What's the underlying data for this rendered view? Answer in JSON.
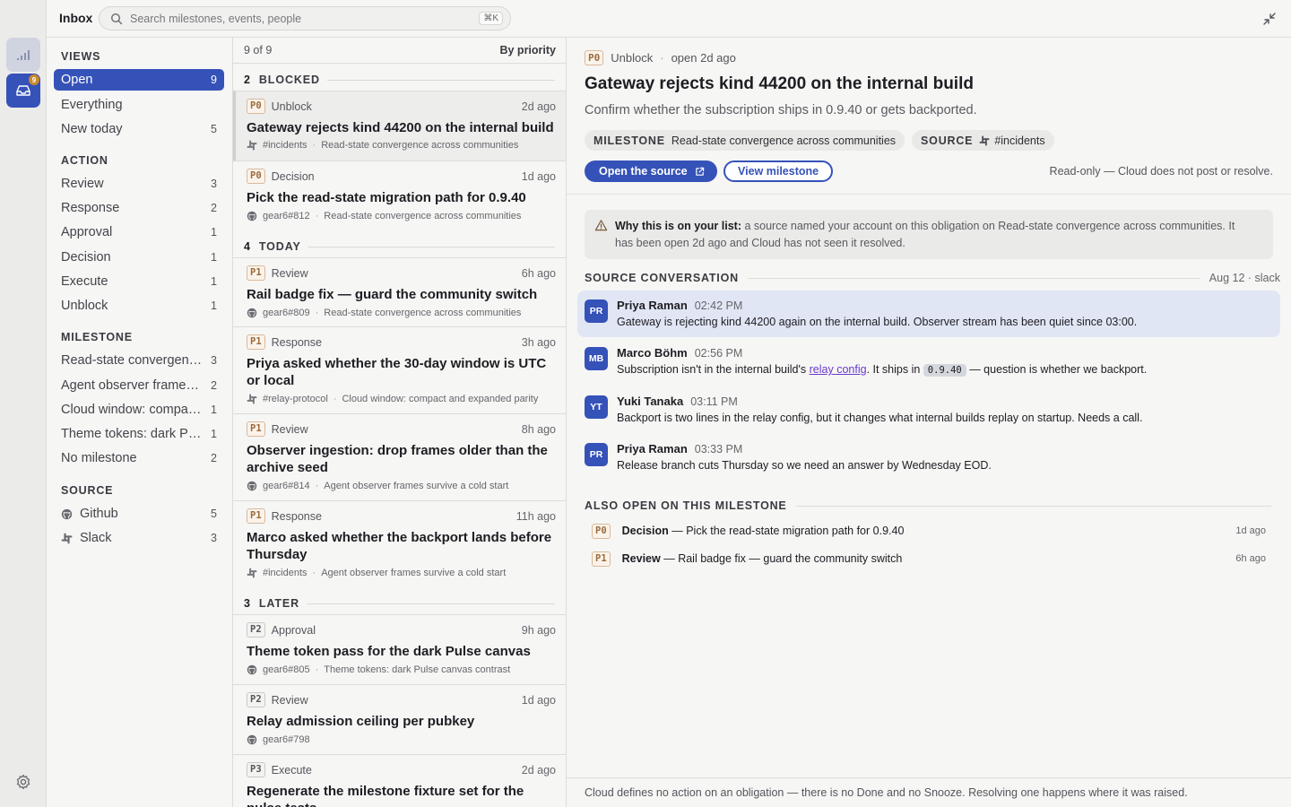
{
  "rail": {
    "inbox_badge": "9",
    "icons": [
      "signal-icon",
      "inbox-icon",
      "gear-icon"
    ]
  },
  "topbar": {
    "title": "Inbox",
    "search_placeholder": "Search milestones, events, people",
    "search_shortcut": "⌘K"
  },
  "sidebar": {
    "views_head": "VIEWS",
    "views": [
      {
        "label": "Open",
        "count": "9"
      },
      {
        "label": "Everything",
        "count": ""
      },
      {
        "label": "New today",
        "count": "5"
      }
    ],
    "action_head": "ACTION",
    "actions": [
      {
        "label": "Review",
        "count": "3"
      },
      {
        "label": "Response",
        "count": "2"
      },
      {
        "label": "Approval",
        "count": "1"
      },
      {
        "label": "Decision",
        "count": "1"
      },
      {
        "label": "Execute",
        "count": "1"
      },
      {
        "label": "Unblock",
        "count": "1"
      }
    ],
    "milestone_head": "MILESTONE",
    "milestones": [
      {
        "label": "Read-state convergence across communities",
        "count": "3"
      },
      {
        "label": "Agent observer frames survive a cold start",
        "count": "2"
      },
      {
        "label": "Cloud window: compact and expanded parity",
        "count": "1"
      },
      {
        "label": "Theme tokens: dark Pulse canvas contrast",
        "count": "1"
      },
      {
        "label": "No milestone",
        "count": "2"
      }
    ],
    "source_head": "SOURCE",
    "sources": [
      {
        "label": "Github",
        "count": "5",
        "icon": "github-icon"
      },
      {
        "label": "Slack",
        "count": "3",
        "icon": "slack-icon"
      }
    ]
  },
  "list": {
    "count": "9 of 9",
    "sort": "By priority",
    "groups": [
      {
        "n": "2",
        "label": "BLOCKED"
      },
      {
        "n": "4",
        "label": "TODAY"
      },
      {
        "n": "3",
        "label": "LATER"
      }
    ],
    "items": [
      {
        "prio": "P0",
        "type": "Unblock",
        "ago": "2d ago",
        "title": "Gateway rejects kind 44200 on the internal build",
        "source": "#incidents",
        "source_icon": "slack-icon",
        "milestone": "Read-state convergence across communities"
      },
      {
        "prio": "P0",
        "type": "Decision",
        "ago": "1d ago",
        "title": "Pick the read-state migration path for 0.9.40",
        "source": "gear6#812",
        "source_icon": "github-icon",
        "milestone": "Read-state convergence across communities"
      },
      {
        "prio": "P1",
        "type": "Review",
        "ago": "6h ago",
        "title": "Rail badge fix — guard the community switch",
        "source": "gear6#809",
        "source_icon": "github-icon",
        "milestone": "Read-state convergence across communities"
      },
      {
        "prio": "P1",
        "type": "Response",
        "ago": "3h ago",
        "title": "Priya asked whether the 30-day window is UTC or local",
        "source": "#relay-protocol",
        "source_icon": "slack-icon",
        "milestone": "Cloud window: compact and expanded parity"
      },
      {
        "prio": "P1",
        "type": "Review",
        "ago": "8h ago",
        "title": "Observer ingestion: drop frames older than the archive seed",
        "source": "gear6#814",
        "source_icon": "github-icon",
        "milestone": "Agent observer frames survive a cold start"
      },
      {
        "prio": "P1",
        "type": "Response",
        "ago": "11h ago",
        "title": "Marco asked whether the backport lands before Thursday",
        "source": "#incidents",
        "source_icon": "slack-icon",
        "milestone": "Agent observer frames survive a cold start"
      },
      {
        "prio": "P2",
        "type": "Approval",
        "ago": "9h ago",
        "title": "Theme token pass for the dark Pulse canvas",
        "source": "gear6#805",
        "source_icon": "github-icon",
        "milestone": "Theme tokens: dark Pulse canvas contrast"
      },
      {
        "prio": "P2",
        "type": "Review",
        "ago": "1d ago",
        "title": "Relay admission ceiling per pubkey",
        "source": "gear6#798",
        "source_icon": "github-icon",
        "milestone": ""
      },
      {
        "prio": "P3",
        "type": "Execute",
        "ago": "2d ago",
        "title": "Regenerate the milestone fixture set for the pulse tests",
        "source": "",
        "source_icon": "",
        "milestone": ""
      }
    ]
  },
  "detail": {
    "prio": "P0",
    "type": "Unblock",
    "age": "open 2d ago",
    "title": "Gateway rejects kind 44200 on the internal build",
    "subtitle": "Confirm whether the subscription ships in 0.9.40 or gets backported.",
    "chip_milestone_key": "MILESTONE",
    "chip_milestone_val": "Read-state convergence across communities",
    "chip_source_key": "SOURCE",
    "chip_source_val": "#incidents",
    "open_source_label": "Open the source",
    "view_milestone_label": "View milestone",
    "readonly_note": "Read-only — Cloud does not post or resolve.",
    "why_label": "Why this is on your list:",
    "why_text": "a source named your account on this obligation on Read-state convergence across communities. It has been open 2d ago and Cloud has not seen it resolved.",
    "conversation_head": "SOURCE CONVERSATION",
    "conversation_meta": "Aug 12 · slack",
    "messages": [
      {
        "initials": "PR",
        "name": "Priya Raman",
        "time": "02:42 PM",
        "text": "Gateway is rejecting kind 44200 again on the internal build. Observer stream has been quiet since 03:00."
      },
      {
        "initials": "MB",
        "name": "Marco Böhm",
        "time": "02:56 PM",
        "text_before": "Subscription isn't in the internal build's ",
        "link": "relay config",
        "text_mid": ". It ships in ",
        "code": "0.9.40",
        "text_after": " — question is whether we backport."
      },
      {
        "initials": "YT",
        "name": "Yuki Tanaka",
        "time": "03:11 PM",
        "text": "Backport is two lines in the relay config, but it changes what internal builds replay on startup. Needs a call."
      },
      {
        "initials": "PR",
        "name": "Priya Raman",
        "time": "03:33 PM",
        "text": "Release branch cuts Thursday so we need an answer by Wednesday EOD."
      }
    ],
    "also_head": "ALSO OPEN ON THIS MILESTONE",
    "also": [
      {
        "prio": "P0",
        "type": "Decision",
        "title": " — Pick the read-state migration path for 0.9.40",
        "ago": "1d ago"
      },
      {
        "prio": "P1",
        "type": "Review",
        "title": " — Rail badge fix — guard the community switch",
        "ago": "6h ago"
      }
    ],
    "footer": "Cloud defines no action on an obligation — there is no Done and no Snooze. Resolving one happens where it was raised."
  },
  "colors": {
    "accent": "#3552b8",
    "link": "#6a3bd0",
    "prio_high": "#9a6a3c"
  }
}
